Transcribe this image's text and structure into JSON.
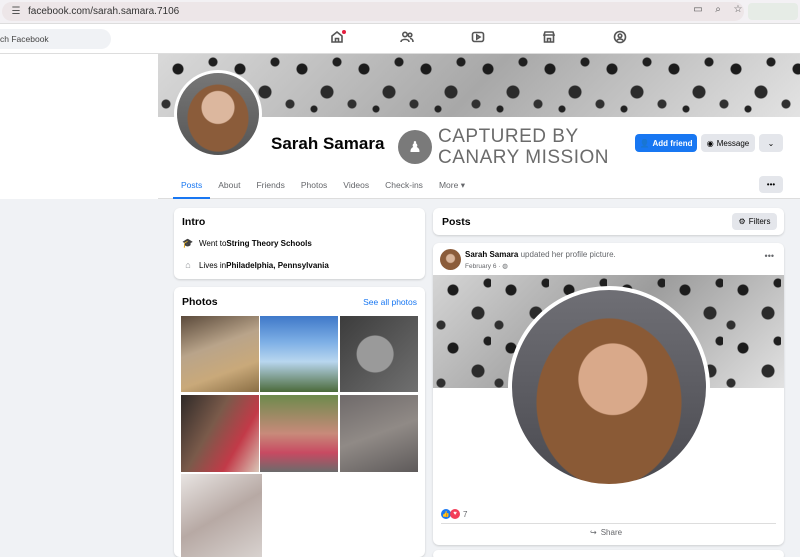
{
  "browser": {
    "url": "facebook.com/sarah.samara.7106"
  },
  "fb_nav": {
    "search_placeholder": "ch Facebook"
  },
  "profile": {
    "name": "Sarah Samara",
    "watermark_line1": "CAPTURED BY",
    "watermark_line2": "CANARY MISSION",
    "add_friend_label": "Add friend",
    "message_label": "Message",
    "tabs": [
      "Posts",
      "About",
      "Friends",
      "Photos",
      "Videos",
      "Check-ins",
      "More"
    ]
  },
  "intro": {
    "title": "Intro",
    "education_prefix": "Went to ",
    "education_school": "String Theory Schools",
    "location_prefix": "Lives in ",
    "location_city": "Philadelphia, Pennsylvania"
  },
  "photos": {
    "title": "Photos",
    "see_all": "See all photos"
  },
  "posts": {
    "title": "Posts",
    "filters_label": "Filters",
    "post": {
      "author": "Sarah Samara",
      "action": " updated her profile picture.",
      "date": "February 6 ·",
      "reaction_count": "7",
      "share_label": "Share"
    }
  },
  "colors": {
    "accent": "#1877f2",
    "background": "#f0f2f5"
  }
}
